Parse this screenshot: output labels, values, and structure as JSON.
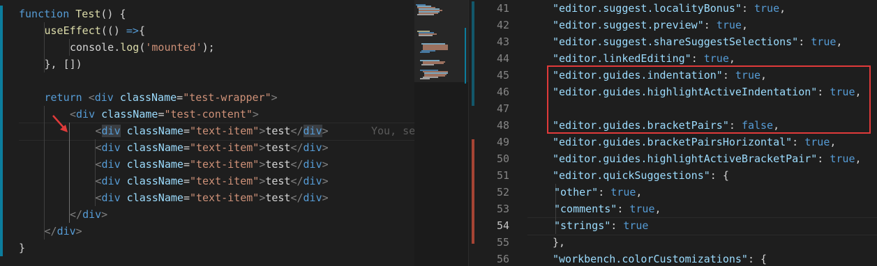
{
  "left_editor": {
    "lines": [
      [
        [
          "kw",
          "function"
        ],
        [
          "plain",
          " "
        ],
        [
          "fn",
          "Test"
        ],
        [
          "plain",
          "() {"
        ]
      ],
      [
        [
          "fn",
          "useEffect"
        ],
        [
          "plain",
          "(() "
        ],
        [
          "arrow",
          "=>"
        ],
        [
          "plain",
          "{"
        ]
      ],
      [
        [
          "plain",
          "console."
        ],
        [
          "fn",
          "log"
        ],
        [
          "plain",
          "("
        ],
        [
          "str",
          "'mounted'"
        ],
        [
          "plain",
          ");"
        ]
      ],
      [
        [
          "plain",
          "}, [])"
        ]
      ],
      [],
      [
        [
          "kw",
          "return"
        ],
        [
          "plain",
          " "
        ],
        [
          "pun",
          "<"
        ],
        [
          "tag",
          "div"
        ],
        [
          "plain",
          " "
        ],
        [
          "attr",
          "className"
        ],
        [
          "plain",
          "="
        ],
        [
          "str",
          "\"test-wrapper\""
        ],
        [
          "pun",
          ">"
        ]
      ],
      [
        [
          "pun",
          "<"
        ],
        [
          "tag",
          "div"
        ],
        [
          "plain",
          " "
        ],
        [
          "attr",
          "className"
        ],
        [
          "plain",
          "="
        ],
        [
          "str",
          "\"test-content\""
        ],
        [
          "pun",
          ">"
        ]
      ],
      [
        [
          "pun",
          "<"
        ],
        [
          "tag",
          "div"
        ],
        [
          "plain",
          " "
        ],
        [
          "attr",
          "className"
        ],
        [
          "plain",
          "="
        ],
        [
          "str",
          "\"text-item\""
        ],
        [
          "pun",
          ">"
        ],
        [
          "plain",
          "test"
        ],
        [
          "pun",
          "</"
        ],
        [
          "tag",
          "div"
        ],
        [
          "pun",
          ">"
        ]
      ],
      [
        [
          "pun",
          "<"
        ],
        [
          "tag",
          "div"
        ],
        [
          "plain",
          " "
        ],
        [
          "attr",
          "className"
        ],
        [
          "plain",
          "="
        ],
        [
          "str",
          "\"text-item\""
        ],
        [
          "pun",
          ">"
        ],
        [
          "plain",
          "test"
        ],
        [
          "pun",
          "</"
        ],
        [
          "tag",
          "div"
        ],
        [
          "pun",
          ">"
        ]
      ],
      [
        [
          "pun",
          "<"
        ],
        [
          "tag",
          "div"
        ],
        [
          "plain",
          " "
        ],
        [
          "attr",
          "className"
        ],
        [
          "plain",
          "="
        ],
        [
          "str",
          "\"text-item\""
        ],
        [
          "pun",
          ">"
        ],
        [
          "plain",
          "test"
        ],
        [
          "pun",
          "</"
        ],
        [
          "tag",
          "div"
        ],
        [
          "pun",
          ">"
        ]
      ],
      [
        [
          "pun",
          "<"
        ],
        [
          "tag",
          "div"
        ],
        [
          "plain",
          " "
        ],
        [
          "attr",
          "className"
        ],
        [
          "plain",
          "="
        ],
        [
          "str",
          "\"text-item\""
        ],
        [
          "pun",
          ">"
        ],
        [
          "plain",
          "test"
        ],
        [
          "pun",
          "</"
        ],
        [
          "tag",
          "div"
        ],
        [
          "pun",
          ">"
        ]
      ],
      [
        [
          "pun",
          "<"
        ],
        [
          "tag",
          "div"
        ],
        [
          "plain",
          " "
        ],
        [
          "attr",
          "className"
        ],
        [
          "plain",
          "="
        ],
        [
          "str",
          "\"text-item\""
        ],
        [
          "pun",
          ">"
        ],
        [
          "plain",
          "test"
        ],
        [
          "pun",
          "</"
        ],
        [
          "tag",
          "div"
        ],
        [
          "pun",
          ">"
        ]
      ],
      [
        [
          "pun",
          "</"
        ],
        [
          "tag",
          "div"
        ],
        [
          "pun",
          ">"
        ]
      ],
      [
        [
          "pun",
          "</"
        ],
        [
          "tag",
          "div"
        ],
        [
          "pun",
          ">"
        ]
      ],
      [
        [
          "plain",
          "}"
        ]
      ]
    ],
    "git_blame_hint": "You, se"
  },
  "right_editor": {
    "line_numbers": [
      "41",
      "42",
      "43",
      "44",
      "45",
      "46",
      "47",
      "48",
      "49",
      "50",
      "51",
      "52",
      "53",
      "54",
      "55",
      "56"
    ],
    "current_line_number": "54",
    "lines": [
      [
        [
          "jkey",
          "\"editor.suggest.localityBonus\""
        ],
        [
          "plain",
          ": "
        ],
        [
          "jval",
          "true"
        ],
        [
          "plain",
          ","
        ]
      ],
      [
        [
          "jkey",
          "\"editor.suggest.preview\""
        ],
        [
          "plain",
          ": "
        ],
        [
          "jval",
          "true"
        ],
        [
          "plain",
          ","
        ]
      ],
      [
        [
          "jkey",
          "\"editor.suggest.shareSuggestSelections\""
        ],
        [
          "plain",
          ": "
        ],
        [
          "jval",
          "true"
        ],
        [
          "plain",
          ","
        ]
      ],
      [
        [
          "jkey",
          "\"editor.linkedEditing\""
        ],
        [
          "plain",
          ": "
        ],
        [
          "jval",
          "true"
        ],
        [
          "plain",
          ","
        ]
      ],
      [
        [
          "jkey",
          "\"editor.guides.indentation\""
        ],
        [
          "plain",
          ": "
        ],
        [
          "jval",
          "true"
        ],
        [
          "plain",
          ","
        ]
      ],
      [
        [
          "jkey",
          "\"editor.guides.highlightActiveIndentation\""
        ],
        [
          "plain",
          ": "
        ],
        [
          "jval",
          "true"
        ],
        [
          "plain",
          ","
        ]
      ],
      [],
      [
        [
          "jkey",
          "\"editor.guides.bracketPairs\""
        ],
        [
          "plain",
          ": "
        ],
        [
          "jval",
          "false"
        ],
        [
          "plain",
          ","
        ]
      ],
      [
        [
          "jkey",
          "\"editor.guides.bracketPairsHorizontal\""
        ],
        [
          "plain",
          ": "
        ],
        [
          "jval",
          "true"
        ],
        [
          "plain",
          ","
        ]
      ],
      [
        [
          "jkey",
          "\"editor.guides.highlightActiveBracketPair\""
        ],
        [
          "plain",
          ": "
        ],
        [
          "jval",
          "true"
        ],
        [
          "plain",
          ","
        ]
      ],
      [
        [
          "jkey",
          "\"editor.quickSuggestions\""
        ],
        [
          "plain",
          ": {"
        ]
      ],
      [
        [
          "jkey",
          "\"other\""
        ],
        [
          "plain",
          ": "
        ],
        [
          "jval",
          "true"
        ],
        [
          "plain",
          ","
        ]
      ],
      [
        [
          "jkey",
          "\"comments\""
        ],
        [
          "plain",
          ": "
        ],
        [
          "jval",
          "true"
        ],
        [
          "plain",
          ","
        ]
      ],
      [
        [
          "jkey",
          "\"strings\""
        ],
        [
          "plain",
          ": "
        ],
        [
          "jval",
          "true"
        ]
      ],
      [
        [
          "plain",
          "},"
        ]
      ],
      [
        [
          "jkey",
          "\"workbench.colorCustomizations\""
        ],
        [
          "plain",
          ": {"
        ]
      ]
    ]
  },
  "colors": {
    "background": "#1e1e1e",
    "keyword": "#569cd6",
    "function": "#dcdcaa",
    "string": "#ce9178",
    "attribute": "#9cdcfe",
    "annotation_red": "#e03a3a",
    "modified_gutter": "#0c7d9d"
  },
  "icons": {
    "annotation_arrow": "red-arrow-icon"
  }
}
